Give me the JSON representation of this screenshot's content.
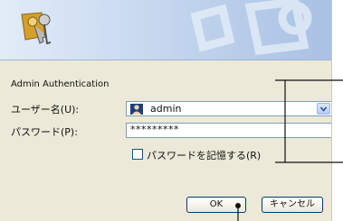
{
  "dialog": {
    "title": "Admin Authentication",
    "username": {
      "label": "ユーザー名(U):",
      "value": "admin"
    },
    "password": {
      "label": "パスワード(P):",
      "value": "*********"
    },
    "remember": {
      "label": "パスワードを記憶する(R)",
      "checked": false
    },
    "buttons": {
      "ok": "OK",
      "cancel": "キャンセル"
    }
  },
  "icons": [
    "keys-icon",
    "user-icon",
    "chevron-down-icon"
  ]
}
